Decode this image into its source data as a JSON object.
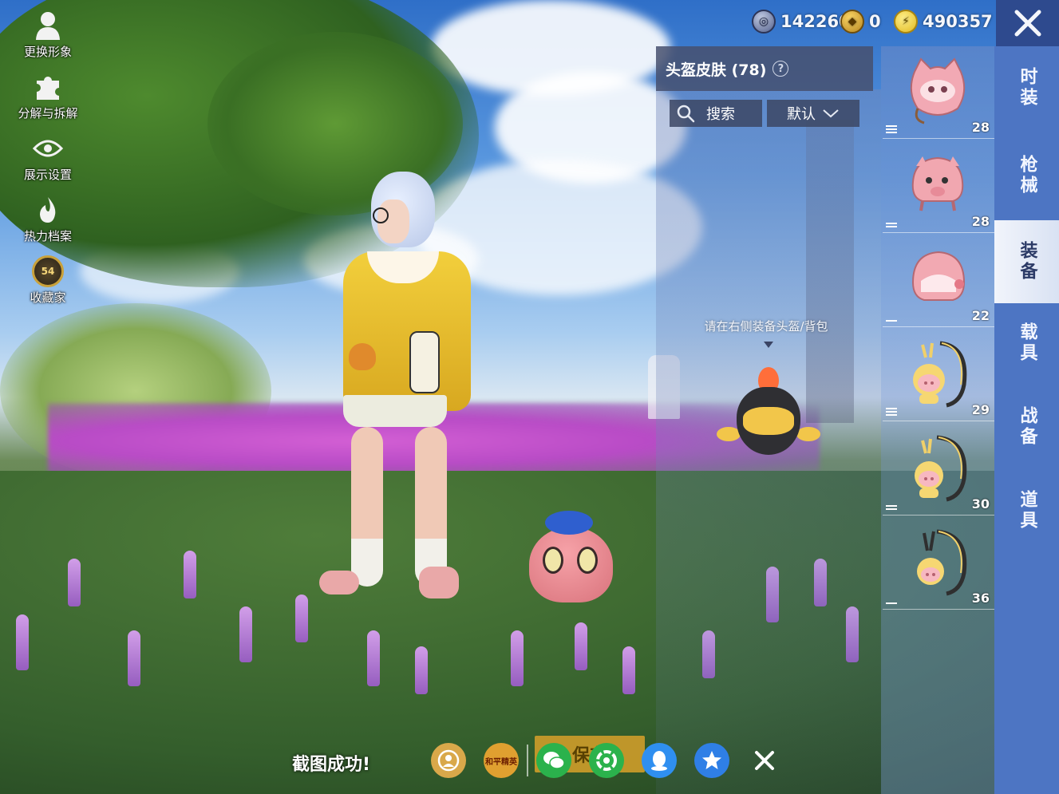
{
  "left_menu": [
    {
      "label": "更换形象",
      "icon": "person-silhouette-icon"
    },
    {
      "label": "分解与拆解",
      "icon": "puzzle-piece-icon"
    },
    {
      "label": "展示设置",
      "icon": "eye-icon"
    },
    {
      "label": "热力档案",
      "icon": "flame-icon"
    },
    {
      "label": "收藏家",
      "icon": "collector-badge-icon",
      "badge": "54"
    }
  ],
  "currency": [
    {
      "value": "142260",
      "icon": "silver-coin-icon"
    },
    {
      "value": "0",
      "icon": "gold-coin-icon"
    },
    {
      "value": "490357",
      "icon": "bp-lightning-coin-icon"
    }
  ],
  "panel": {
    "title": "头盔皮肤 (78)",
    "search_label": "搜索",
    "sort_label": "默认",
    "hint": "请在右侧装备头盔/背包"
  },
  "items": [
    {
      "count": "28",
      "kind": "pink cat helmet",
      "level": 3
    },
    {
      "count": "28",
      "kind": "pink pig helmet",
      "level": 2
    },
    {
      "count": "22",
      "kind": "pink round helmet",
      "level": 1
    },
    {
      "count": "29",
      "kind": "piggy backpack",
      "level": 3
    },
    {
      "count": "30",
      "kind": "piggy backpack",
      "level": 2
    },
    {
      "count": "36",
      "kind": "piggy backpack",
      "level": 1
    }
  ],
  "tabs": [
    {
      "label": "时装",
      "active": false
    },
    {
      "label": "枪械",
      "active": false
    },
    {
      "label": "装备",
      "active": true
    },
    {
      "label": "载具",
      "active": false
    },
    {
      "label": "战备",
      "active": false
    },
    {
      "label": "道具",
      "active": false
    }
  ],
  "toast": "截图成功!",
  "save_button": "保存",
  "share": [
    {
      "icon": "game-share-icon",
      "label": ""
    },
    {
      "icon": "peace-elite-icon",
      "label": "和平精英"
    },
    {
      "icon": "wechat-icon",
      "label": ""
    },
    {
      "icon": "moments-icon",
      "label": ""
    },
    {
      "icon": "qq-icon",
      "label": ""
    },
    {
      "icon": "qzone-icon",
      "label": ""
    },
    {
      "icon": "close-icon",
      "label": ""
    }
  ],
  "colors": {
    "tab_bg": "#4d75c3",
    "tab_active_bg": "#e8edf7",
    "accent_gold": "#c79a2a"
  }
}
